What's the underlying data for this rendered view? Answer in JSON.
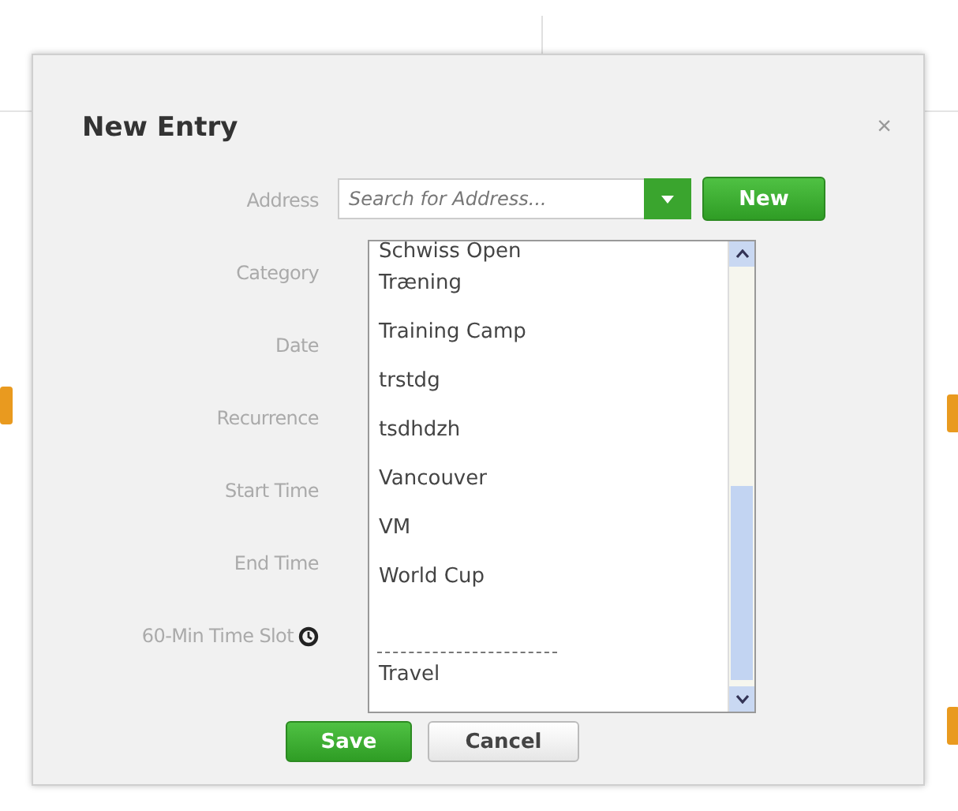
{
  "dialog": {
    "title": "New Entry",
    "close": "×"
  },
  "fields": [
    {
      "label": "Address",
      "kind": "search",
      "placeholder": "Search for Address..."
    },
    {
      "label": "Category",
      "kind": "plain"
    },
    {
      "label": "Date",
      "kind": "plain"
    },
    {
      "label": "Recurrence",
      "kind": "plain"
    },
    {
      "label": "Start Time",
      "kind": "plain"
    },
    {
      "label": "End Time",
      "kind": "plain"
    },
    {
      "label": "60-Min Time Slot",
      "kind": "clock"
    }
  ],
  "new_button": "New",
  "dropdown": {
    "items": [
      {
        "kind": "option",
        "text": "Schwiss Open"
      },
      {
        "kind": "option",
        "text": "Træning"
      },
      {
        "kind": "option",
        "text": "Training Camp"
      },
      {
        "kind": "option",
        "text": "trstdg"
      },
      {
        "kind": "option",
        "text": "tsdhdzh"
      },
      {
        "kind": "option",
        "text": "Vancouver"
      },
      {
        "kind": "option",
        "text": "VM"
      },
      {
        "kind": "option",
        "text": "World Cup"
      },
      {
        "kind": "separator"
      },
      {
        "kind": "option",
        "text": "Travel"
      }
    ]
  },
  "buttons": [
    {
      "label": "Save",
      "kind": "primary"
    },
    {
      "label": "Cancel",
      "kind": "secondary"
    }
  ]
}
